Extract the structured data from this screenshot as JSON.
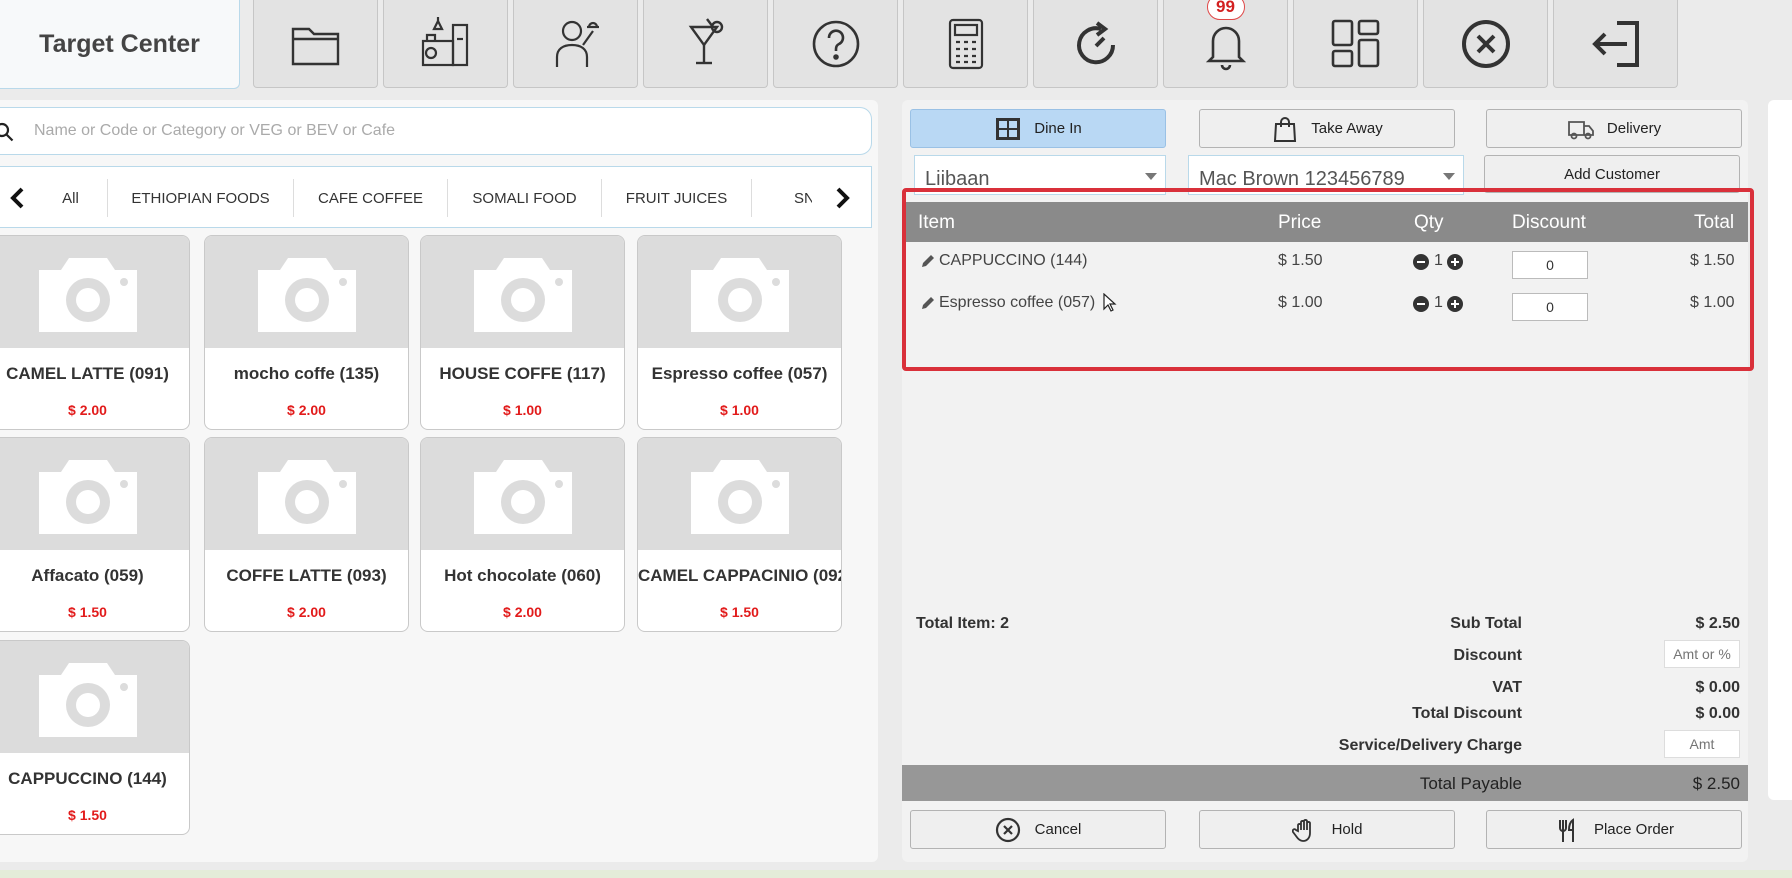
{
  "app": {
    "title": "Target Center"
  },
  "toolbar": {
    "buttons": [
      {
        "icon": "folder-icon"
      },
      {
        "icon": "kitchen-icon"
      },
      {
        "icon": "waiter-icon"
      },
      {
        "icon": "cocktail-icon"
      },
      {
        "icon": "help-icon"
      },
      {
        "icon": "calculator-icon"
      },
      {
        "icon": "refresh-icon"
      },
      {
        "icon": "bell-icon",
        "badge": "99"
      },
      {
        "icon": "dashboard-icon"
      },
      {
        "icon": "close-circle-icon"
      },
      {
        "icon": "logout-icon"
      }
    ]
  },
  "search": {
    "placeholder": "Name or Code or Category or VEG or BEV or Cafe",
    "value": ""
  },
  "categories": [
    "All",
    "ETHIOPIAN FOODS",
    "CAFE COFFEE",
    "SOMALI FOOD",
    "FRUIT JUICES",
    "SNA"
  ],
  "products": [
    {
      "name": "CAMEL LATTE (091)",
      "price": "$ 2.00"
    },
    {
      "name": "mocho coffe (135)",
      "price": "$ 2.00"
    },
    {
      "name": "HOUSE COFFE (117)",
      "price": "$ 1.00"
    },
    {
      "name": "Espresso coffee (057)",
      "price": "$ 1.00"
    },
    {
      "name": "Affacato (059)",
      "price": "$ 1.50"
    },
    {
      "name": "COFFE LATTE (093)",
      "price": "$ 2.00"
    },
    {
      "name": "Hot chocolate (060)",
      "price": "$ 2.00"
    },
    {
      "name": "CAMEL CAPPACINIO (092",
      "price": "$ 1.50"
    },
    {
      "name": "CAPPUCCINO (144)",
      "price": "$ 1.50"
    }
  ],
  "order_modes": [
    {
      "label": "Dine In",
      "icon": "table-icon",
      "active": true
    },
    {
      "label": "Take Away",
      "icon": "shopping-bag-icon",
      "active": false
    },
    {
      "label": "Delivery",
      "icon": "truck-icon",
      "active": false
    }
  ],
  "table_select": {
    "value": "Liibaan"
  },
  "customer_select": {
    "value": "Mac Brown 123456789"
  },
  "add_customer_label": "Add Customer",
  "order_table": {
    "headers": {
      "item": "Item",
      "price": "Price",
      "qty": "Qty",
      "discount": "Discount",
      "total": "Total"
    },
    "rows": [
      {
        "item": "CAPPUCCINO (144)",
        "price": "$ 1.50",
        "qty": "1",
        "discount": "0",
        "total": "$ 1.50"
      },
      {
        "item": "Espresso coffee (057)",
        "price": "$ 1.00",
        "qty": "1",
        "discount": "0",
        "total": "$ 1.00"
      }
    ]
  },
  "summary": {
    "total_items": "Total Item: 2",
    "sub_total_label": "Sub Total",
    "sub_total": "$ 2.50",
    "discount_label": "Discount",
    "discount_placeholder": "Amt or %",
    "vat_label": "VAT",
    "vat": "$ 0.00",
    "total_discount_label": "Total Discount",
    "total_discount": "$ 0.00",
    "service_label": "Service/Delivery Charge",
    "service_placeholder": "Amt",
    "payable_label": "Total Payable",
    "payable": "$ 2.50"
  },
  "footer_buttons": [
    {
      "label": "Cancel",
      "icon": "cancel-icon"
    },
    {
      "label": "Hold",
      "icon": "hand-icon"
    },
    {
      "label": "Place Order",
      "icon": "cutlery-icon"
    }
  ],
  "colors": {
    "accent": "#b9d8f4",
    "price_red": "#e21b1b",
    "highlight": "#d9303a",
    "header_gray": "#8a8a8a"
  }
}
